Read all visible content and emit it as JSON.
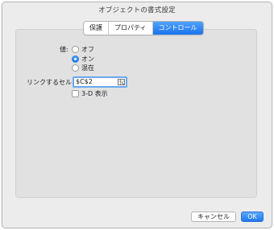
{
  "dialog": {
    "title": "オブジェクトの書式設定"
  },
  "tabs": [
    {
      "label": "保護",
      "active": false
    },
    {
      "label": "プロパティ",
      "active": false
    },
    {
      "label": "コントロール",
      "active": true
    }
  ],
  "value_section": {
    "label": "値:",
    "options": [
      {
        "label": "オフ",
        "selected": false
      },
      {
        "label": "オン",
        "selected": true
      },
      {
        "label": "混在",
        "selected": false
      }
    ]
  },
  "link_cell": {
    "label": "リンクするセル:",
    "value": "$C$2"
  },
  "shading_3d": {
    "label": "3-D 表示",
    "checked": false
  },
  "buttons": {
    "cancel_label": "キャンセル",
    "ok_label": "OK"
  },
  "colors": {
    "accent": "#1b73ee",
    "dialog_bg": "#ececec",
    "panel_bg": "#e1e1e1"
  }
}
